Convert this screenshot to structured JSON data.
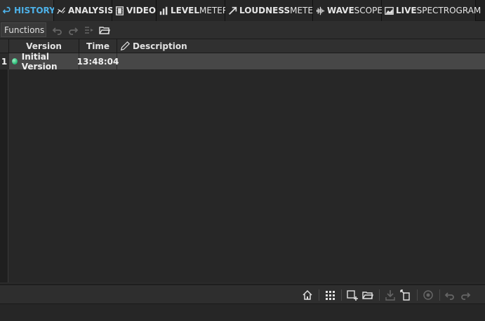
{
  "tabs": [
    {
      "bold": "HISTORY",
      "rest": "",
      "icon": "undo-arrow-icon",
      "active": true
    },
    {
      "bold": "ANALYSIS",
      "rest": "",
      "icon": "analysis-icon",
      "active": false
    },
    {
      "bold": "VIDEO",
      "rest": "",
      "icon": "film-icon",
      "active": false
    },
    {
      "bold": "LEVEL",
      "rest": "METER",
      "icon": "bars-icon",
      "active": false
    },
    {
      "bold": "LOUDNESS",
      "rest": "METER",
      "icon": "diagonal-arrow-icon",
      "active": false
    },
    {
      "bold": "WAVE",
      "rest": "SCOPE",
      "icon": "waveform-icon",
      "active": false
    },
    {
      "bold": "LIVE",
      "rest": "SPECTROGRAM",
      "icon": "spectrogram-icon",
      "active": false
    }
  ],
  "toolbar": {
    "functions_label": "Functions"
  },
  "table": {
    "columns": {
      "version": "Version",
      "time": "Time",
      "description": "Description"
    },
    "rows": [
      {
        "index": "1",
        "version": "Initial Version",
        "time": "13:48:04",
        "description": ""
      }
    ]
  },
  "colors": {
    "accent": "#4db1e8",
    "row_selected": "#474747",
    "version_dot": "#2fbf7c"
  }
}
